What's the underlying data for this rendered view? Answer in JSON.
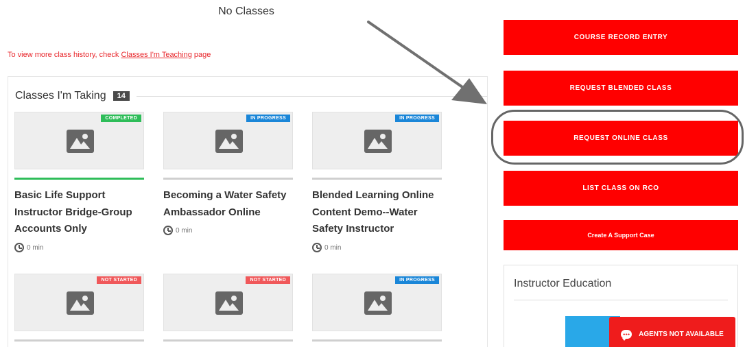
{
  "teaching": {
    "empty_text": "No Classes",
    "history_prefix": "To view more class history, check ",
    "history_link": "Classes I'm Teaching",
    "history_suffix": " page"
  },
  "taking": {
    "title": "Classes I'm Taking",
    "count": "14",
    "cards": [
      {
        "status": "COMPLETED",
        "status_color": "#2ebd59",
        "progress": 1.0,
        "title": "Basic Life Support Instructor Bridge-Group Accounts Only",
        "duration": "0 min"
      },
      {
        "status": "IN PROGRESS",
        "status_color": "#1a86d8",
        "progress": 0,
        "title": "Becoming a Water Safety Ambassador Online",
        "duration": "0 min"
      },
      {
        "status": "IN PROGRESS",
        "status_color": "#1a86d8",
        "progress": 0,
        "title": "Blended Learning Online Content Demo--Water Safety Instructor",
        "duration": "0 min"
      },
      {
        "status": "NOT STARTED",
        "status_color": "#f0585a",
        "progress": 0,
        "title": "",
        "duration": ""
      },
      {
        "status": "NOT STARTED",
        "status_color": "#f0585a",
        "progress": 0,
        "title": "",
        "duration": ""
      },
      {
        "status": "IN PROGRESS",
        "status_color": "#1a86d8",
        "progress": 0,
        "title": "",
        "duration": ""
      }
    ]
  },
  "actions": {
    "course_record_entry": "COURSE RECORD ENTRY",
    "request_blended_class": "REQUEST BLENDED CLASS",
    "request_online_class": "REQUEST ONLINE CLASS",
    "list_class_on_rco": "LIST CLASS ON RCO",
    "create_support_case": "Create A Support Case"
  },
  "instructor_education": {
    "title": "Instructor Education"
  },
  "chat": {
    "label": "AGENTS NOT AVAILABLE",
    "icon": "chat-bubble-icon"
  },
  "colors": {
    "brand_red": "#ff0000",
    "completed": "#2ebd59",
    "in_progress": "#1a86d8",
    "not_started": "#f0585a"
  }
}
